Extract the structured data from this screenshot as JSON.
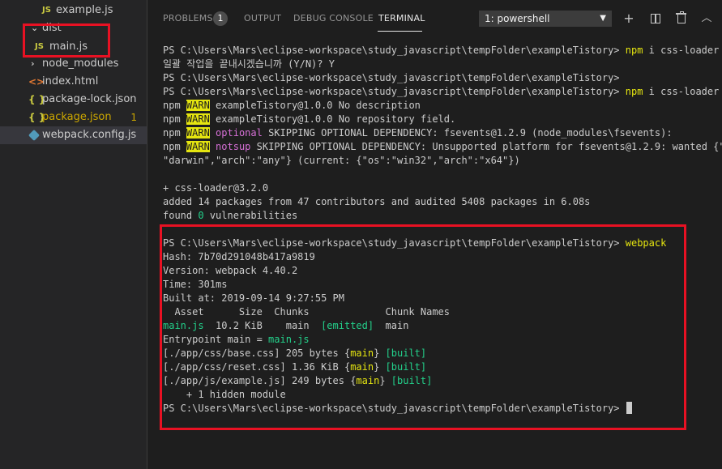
{
  "explorer": {
    "items": [
      {
        "label": "example.js",
        "type": "js"
      },
      {
        "label": "dist",
        "type": "folder"
      },
      {
        "label": "main.js",
        "type": "js"
      },
      {
        "label": "node_modules",
        "type": "folder"
      },
      {
        "label": "index.html",
        "type": "html"
      },
      {
        "label": "package-lock.json",
        "type": "json"
      },
      {
        "label": "package.json",
        "type": "json",
        "badge": "1"
      },
      {
        "label": "webpack.config.js",
        "type": "webpack"
      }
    ],
    "icon_text": {
      "js": "JS",
      "json": "{ }",
      "html": "<>"
    }
  },
  "panel": {
    "tabs": [
      {
        "label": "PROBLEMS",
        "badge": "1"
      },
      {
        "label": "OUTPUT"
      },
      {
        "label": "DEBUG CONSOLE"
      },
      {
        "label": "TERMINAL",
        "active": true
      }
    ],
    "shell_selector": "1: powershell",
    "actions": [
      "add-icon",
      "split-icon",
      "trash-icon",
      "chevron-up-icon"
    ]
  },
  "terminal": {
    "lines": [
      [
        {
          "t": "PS C:\\Users\\Mars\\eclipse-workspace\\study_javascript\\tempFolder\\exampleTistory> "
        },
        {
          "t": "npm",
          "c": "y"
        },
        {
          "t": " i css-loader -"
        }
      ],
      [
        {
          "t": "일괄 작업을 끝내시겠습니까 (Y/N)? Y"
        }
      ],
      [
        {
          "t": "PS C:\\Users\\Mars\\eclipse-workspace\\study_javascript\\tempFolder\\exampleTistory>"
        }
      ],
      [
        {
          "t": "PS C:\\Users\\Mars\\eclipse-workspace\\study_javascript\\tempFolder\\exampleTistory> "
        },
        {
          "t": "npm",
          "c": "y"
        },
        {
          "t": " i css-loader -D"
        }
      ],
      [
        {
          "t": "npm "
        },
        {
          "t": "WARN",
          "c": "warn"
        },
        {
          "t": " exampleTistory@1.0.0 No description"
        }
      ],
      [
        {
          "t": "npm "
        },
        {
          "t": "WARN",
          "c": "warn"
        },
        {
          "t": " exampleTistory@1.0.0 No repository field."
        }
      ],
      [
        {
          "t": "npm "
        },
        {
          "t": "WARN",
          "c": "warn"
        },
        {
          "t": " "
        },
        {
          "t": "optional",
          "c": "m"
        },
        {
          "t": " SKIPPING OPTIONAL DEPENDENCY: fsevents@1.2.9 (node_modules\\fsevents):"
        }
      ],
      [
        {
          "t": "npm "
        },
        {
          "t": "WARN",
          "c": "warn"
        },
        {
          "t": " "
        },
        {
          "t": "notsup",
          "c": "m"
        },
        {
          "t": " SKIPPING OPTIONAL DEPENDENCY: Unsupported platform for fsevents@1.2.9: wanted {\"os\":"
        }
      ],
      [
        {
          "t": "\"darwin\",\"arch\":\"any\"} (current: {\"os\":\"win32\",\"arch\":\"x64\"})"
        }
      ],
      [
        {
          "t": ""
        }
      ],
      [
        {
          "t": "+ css-loader@3.2.0"
        }
      ],
      [
        {
          "t": "added 14 packages from 47 contributors and audited 5408 packages in 6.08s"
        }
      ],
      [
        {
          "t": "found "
        },
        {
          "t": "0",
          "c": "g"
        },
        {
          "t": " vulnerabilities"
        }
      ],
      [
        {
          "t": ""
        }
      ],
      [
        {
          "t": "PS C:\\Users\\Mars\\eclipse-workspace\\study_javascript\\tempFolder\\exampleTistory> "
        },
        {
          "t": "webpack",
          "c": "y"
        }
      ],
      [
        {
          "t": "Hash: 7b70d291048b417a9819"
        }
      ],
      [
        {
          "t": "Version: webpack 4.40.2"
        }
      ],
      [
        {
          "t": "Time: 301ms"
        }
      ],
      [
        {
          "t": "Built at: 2019-09-14 9:27:55 PM"
        }
      ],
      [
        {
          "t": "  Asset      Size  Chunks             Chunk Names"
        }
      ],
      [
        {
          "t": "main.js",
          "c": "g"
        },
        {
          "t": "  10.2 KiB    main  "
        },
        {
          "t": "[emitted]",
          "c": "g"
        },
        {
          "t": "  main"
        }
      ],
      [
        {
          "t": "Entrypoint main = "
        },
        {
          "t": "main.js",
          "c": "g"
        }
      ],
      [
        {
          "t": "[./app/css/base.css] 205 bytes {"
        },
        {
          "t": "main",
          "c": "y"
        },
        {
          "t": "} "
        },
        {
          "t": "[built]",
          "c": "g"
        }
      ],
      [
        {
          "t": "[./app/css/reset.css] 1.36 KiB {"
        },
        {
          "t": "main",
          "c": "y"
        },
        {
          "t": "} "
        },
        {
          "t": "[built]",
          "c": "g"
        }
      ],
      [
        {
          "t": "[./app/js/example.js] 249 bytes {"
        },
        {
          "t": "main",
          "c": "y"
        },
        {
          "t": "} "
        },
        {
          "t": "[built]",
          "c": "g"
        }
      ],
      [
        {
          "t": "    + 1 hidden module"
        }
      ],
      [
        {
          "t": "PS C:\\Users\\Mars\\eclipse-workspace\\study_javascript\\tempFolder\\exampleTistory> "
        }
      ]
    ]
  },
  "colors": {
    "annotation_red": "#e81123",
    "terminal_yellow": "#e5e510",
    "terminal_green": "#23d18b",
    "terminal_magenta": "#d670d6"
  }
}
